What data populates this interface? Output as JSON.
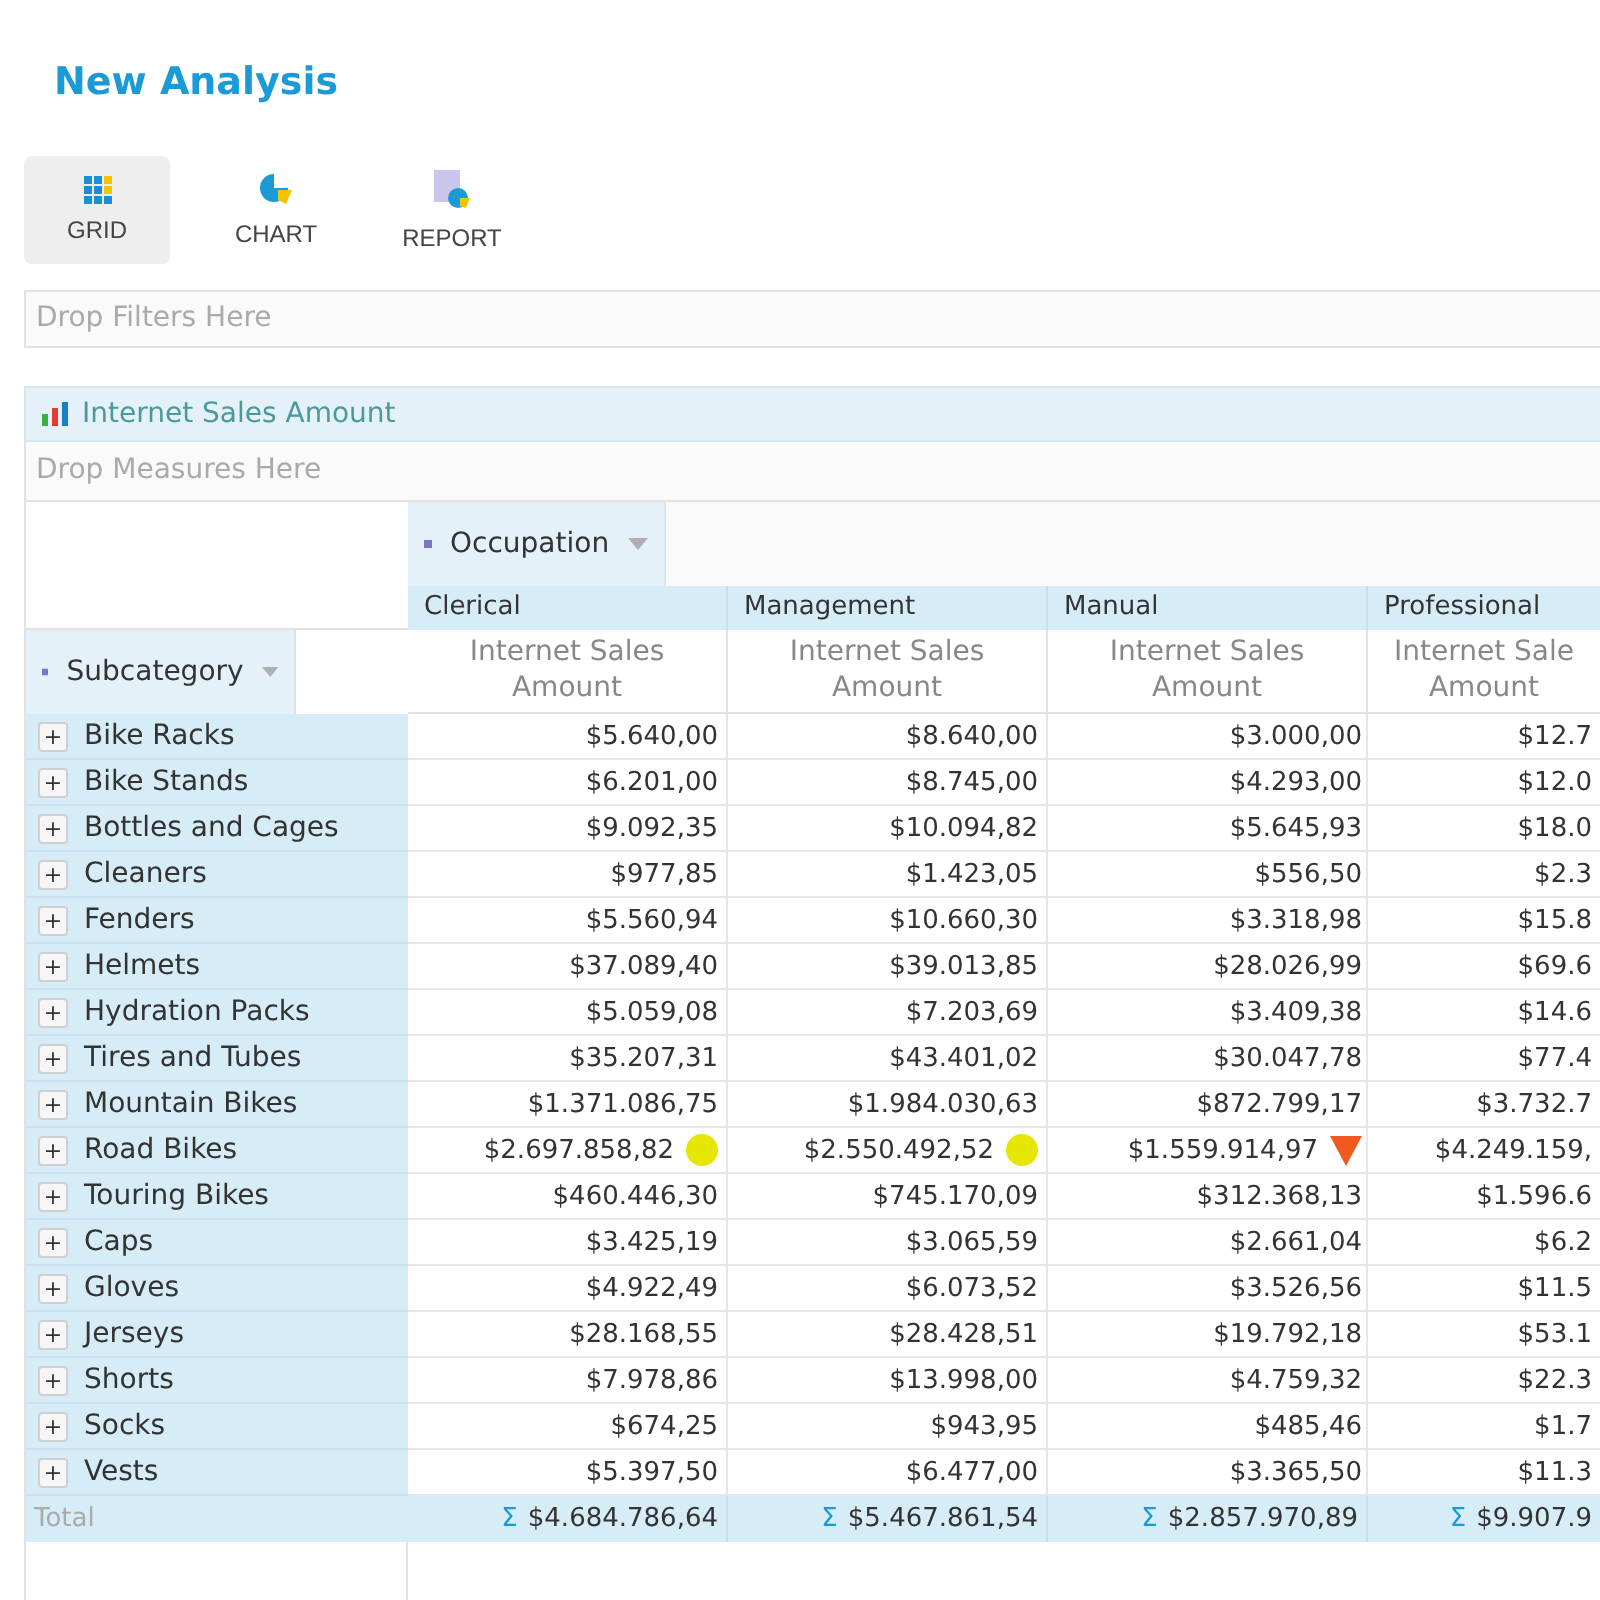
{
  "title": "New Analysis",
  "views": [
    {
      "kind": "grid",
      "label": "GRID",
      "selected": true
    },
    {
      "kind": "chart",
      "label": "CHART",
      "selected": false
    },
    {
      "kind": "report",
      "label": "REPORT",
      "selected": false
    }
  ],
  "filters_placeholder": "Drop Filters Here",
  "measures": {
    "title": "Internet Sales Amount",
    "placeholder": "Drop Measures Here"
  },
  "pivot": {
    "column_field": "Occupation",
    "row_field": "Subcategory",
    "columns": [
      {
        "label": "Clerical",
        "measure": "Internet Sales\nAmount"
      },
      {
        "label": "Management",
        "measure": "Internet Sales\nAmount"
      },
      {
        "label": "Manual",
        "measure": "Internet Sales\nAmount"
      },
      {
        "label": "Professional",
        "measure": "Internet Sale\nAmount"
      }
    ],
    "expander": "+",
    "rows": [
      {
        "label": "Bike Racks",
        "cells": [
          {
            "value": "$5.640,00"
          },
          {
            "value": "$8.640,00"
          },
          {
            "value": "$3.000,00"
          },
          {
            "value": "$12.7"
          }
        ]
      },
      {
        "label": "Bike Stands",
        "cells": [
          {
            "value": "$6.201,00"
          },
          {
            "value": "$8.745,00"
          },
          {
            "value": "$4.293,00"
          },
          {
            "value": "$12.0"
          }
        ]
      },
      {
        "label": "Bottles and Cages",
        "cells": [
          {
            "value": "$9.092,35"
          },
          {
            "value": "$10.094,82"
          },
          {
            "value": "$5.645,93"
          },
          {
            "value": "$18.0"
          }
        ]
      },
      {
        "label": "Cleaners",
        "cells": [
          {
            "value": "$977,85"
          },
          {
            "value": "$1.423,05"
          },
          {
            "value": "$556,50"
          },
          {
            "value": "$2.3"
          }
        ]
      },
      {
        "label": "Fenders",
        "cells": [
          {
            "value": "$5.560,94"
          },
          {
            "value": "$10.660,30"
          },
          {
            "value": "$3.318,98"
          },
          {
            "value": "$15.8"
          }
        ]
      },
      {
        "label": "Helmets",
        "cells": [
          {
            "value": "$37.089,40"
          },
          {
            "value": "$39.013,85"
          },
          {
            "value": "$28.026,99"
          },
          {
            "value": "$69.6"
          }
        ]
      },
      {
        "label": "Hydration Packs",
        "cells": [
          {
            "value": "$5.059,08"
          },
          {
            "value": "$7.203,69"
          },
          {
            "value": "$3.409,38"
          },
          {
            "value": "$14.6"
          }
        ]
      },
      {
        "label": "Tires and Tubes",
        "cells": [
          {
            "value": "$35.207,31"
          },
          {
            "value": "$43.401,02"
          },
          {
            "value": "$30.047,78"
          },
          {
            "value": "$77.4"
          }
        ]
      },
      {
        "label": "Mountain Bikes",
        "cells": [
          {
            "value": "$1.371.086,75"
          },
          {
            "value": "$1.984.030,63"
          },
          {
            "value": "$872.799,17"
          },
          {
            "value": "$3.732.7"
          }
        ]
      },
      {
        "label": "Road Bikes",
        "cells": [
          {
            "value": "$2.697.858,82",
            "indicator": {
              "kind": "circle",
              "color": "#e6e600"
            }
          },
          {
            "value": "$2.550.492,52",
            "indicator": {
              "kind": "circle",
              "color": "#e6e600"
            }
          },
          {
            "value": "$1.559.914,97",
            "indicator": {
              "kind": "down-triangle",
              "color": "#f05a1e"
            }
          },
          {
            "value": "$4.249.159,"
          }
        ]
      },
      {
        "label": "Touring Bikes",
        "cells": [
          {
            "value": "$460.446,30"
          },
          {
            "value": "$745.170,09"
          },
          {
            "value": "$312.368,13"
          },
          {
            "value": "$1.596.6"
          }
        ]
      },
      {
        "label": "Caps",
        "cells": [
          {
            "value": "$3.425,19"
          },
          {
            "value": "$3.065,59"
          },
          {
            "value": "$2.661,04"
          },
          {
            "value": "$6.2"
          }
        ]
      },
      {
        "label": "Gloves",
        "cells": [
          {
            "value": "$4.922,49"
          },
          {
            "value": "$6.073,52"
          },
          {
            "value": "$3.526,56"
          },
          {
            "value": "$11.5"
          }
        ]
      },
      {
        "label": "Jerseys",
        "cells": [
          {
            "value": "$28.168,55"
          },
          {
            "value": "$28.428,51"
          },
          {
            "value": "$19.792,18"
          },
          {
            "value": "$53.1"
          }
        ]
      },
      {
        "label": "Shorts",
        "cells": [
          {
            "value": "$7.978,86"
          },
          {
            "value": "$13.998,00"
          },
          {
            "value": "$4.759,32"
          },
          {
            "value": "$22.3"
          }
        ]
      },
      {
        "label": "Socks",
        "cells": [
          {
            "value": "$674,25"
          },
          {
            "value": "$943,95"
          },
          {
            "value": "$485,46"
          },
          {
            "value": "$1.7"
          }
        ]
      },
      {
        "label": "Vests",
        "cells": [
          {
            "value": "$5.397,50"
          },
          {
            "value": "$6.477,00"
          },
          {
            "value": "$3.365,50"
          },
          {
            "value": "$11.3"
          }
        ]
      }
    ],
    "total": {
      "label": "Total",
      "cells": [
        {
          "sigma": "Σ",
          "value": "$4.684.786,64"
        },
        {
          "sigma": "Σ",
          "value": "$5.467.861,54"
        },
        {
          "sigma": "Σ",
          "value": "$2.857.970,89"
        },
        {
          "sigma": "Σ",
          "value": "$9.907.9"
        }
      ]
    }
  }
}
